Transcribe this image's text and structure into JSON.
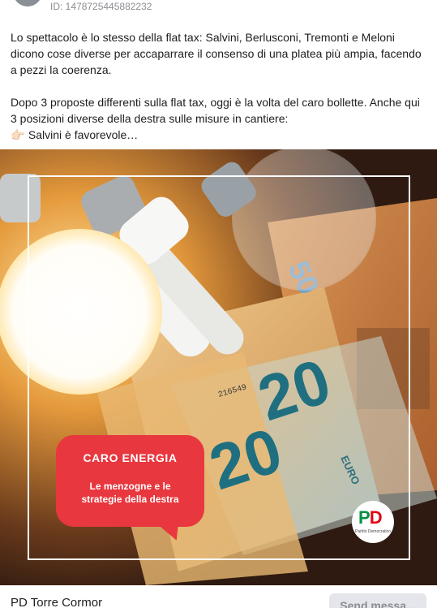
{
  "post": {
    "ad_id": "ID: 1478725445882232",
    "paragraph1": "Lo spettacolo è lo stesso della flat tax: Salvini, Berlusconi, Tremonti e Meloni dicono cose diverse per accaparrare il consenso di una platea più ampia, facendo a pezzi la coerenza.",
    "paragraph2": "Dopo 3 proposte differenti sulla flat tax, oggi è la volta del caro bollette. Anche qui 3 posizioni diverse della destra sulle misure in cantiere:",
    "bullet_emoji": "👉🏻",
    "bullet_text": "Salvini è favorevole…"
  },
  "creative": {
    "title": "CARO ENERGIA",
    "subtitle_line1": "Le menzogne e le",
    "subtitle_line2": "strategie della destra",
    "logo_mark_p": "P",
    "logo_mark_d": "D",
    "logo_caption": "Partito Democratico",
    "banknote_serial": "216549",
    "banknote_value": "20",
    "banknote_value_50": "50",
    "banknote_currency": "EURO",
    "accent_color": "#e8373e"
  },
  "footer": {
    "page_name": "PD Torre Cormor",
    "send_button": "Send messa..."
  }
}
